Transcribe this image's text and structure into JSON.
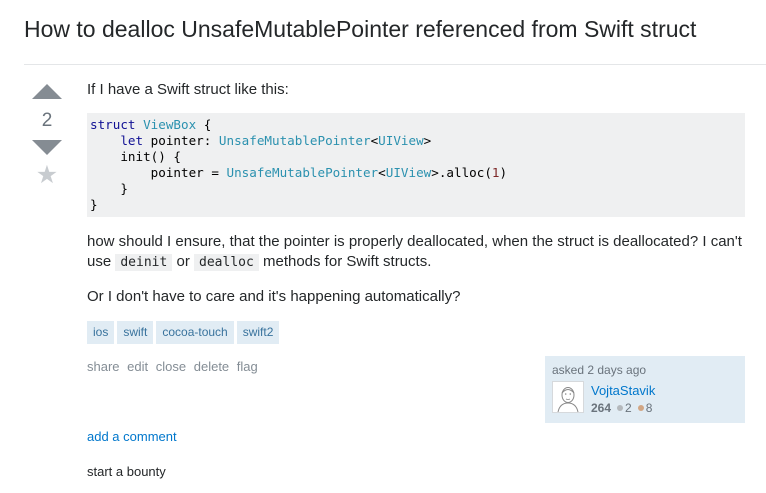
{
  "question": {
    "title": "How to dealloc UnsafeMutablePointer referenced from Swift struct",
    "score": "2",
    "intro": "If I have a Swift struct like this:",
    "code": {
      "l1_kw": "struct",
      "l1_name": "ViewBox",
      "l1_rest": " {",
      "l2_kw": "let",
      "l2_mid": " pointer: ",
      "l2_type": "UnsafeMutablePointer",
      "l2_lt": "<",
      "l2_type2": "UIView",
      "l2_gt": ">",
      "l3": "init() {",
      "l4_a": "pointer = ",
      "l4_type": "UnsafeMutablePointer",
      "l4_lt": "<",
      "l4_type2": "UIView",
      "l4_b": ">.alloc(",
      "l4_num": "1",
      "l4_c": ")",
      "l5": "}",
      "l6": "}"
    },
    "body_a": "how should I ensure, that the pointer is properly deallocated, when the struct is deallocated? I can't use ",
    "code_deinit": "deinit",
    "body_or": " or ",
    "code_dealloc": "dealloc",
    "body_b": " methods for Swift structs.",
    "body2": "Or I don't have to care and it's happening automatically?",
    "tags": [
      "ios",
      "swift",
      "cocoa-touch",
      "swift2"
    ]
  },
  "actions": {
    "share": "share",
    "edit": "edit",
    "close": "close",
    "delete": "delete",
    "flag": "flag"
  },
  "owner": {
    "asked": "asked 2 days ago",
    "name": "VojtaStavik",
    "reputation": "264",
    "silver": "2",
    "bronze": "8"
  },
  "links": {
    "add_comment": "add a comment",
    "bounty": "start a bounty"
  },
  "icons": {
    "upvote": "triangle-up-icon",
    "downvote": "triangle-down-icon",
    "favorite": "star-icon"
  },
  "colors": {
    "link": "#0077cc",
    "tag_bg": "#e1ecf4",
    "tag_text": "#39739d",
    "code_bg": "#eff0f1"
  }
}
